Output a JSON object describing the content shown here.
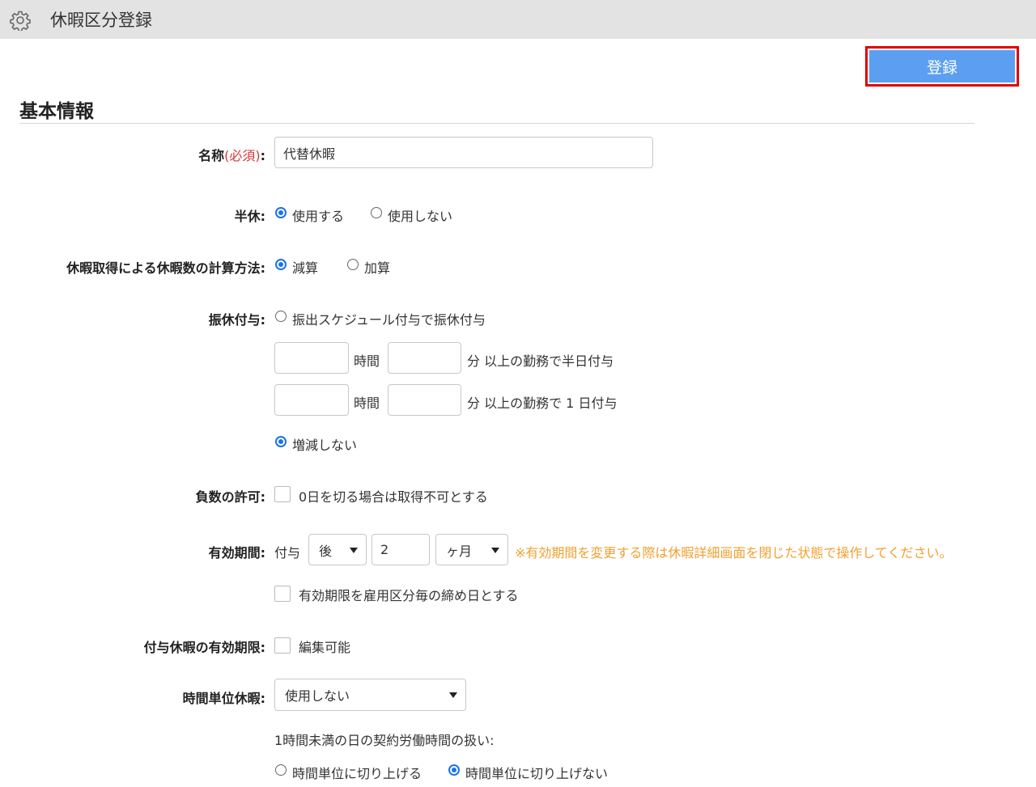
{
  "header": {
    "title": "休暇区分登録",
    "icon": "gear-icon"
  },
  "actions": {
    "submit_label": "登録"
  },
  "section": {
    "title": "基本情報"
  },
  "name_field": {
    "label": "名称",
    "required": "(必須)",
    "colon": ":",
    "value": "代替休暇"
  },
  "half_day": {
    "label": "半休:",
    "options": [
      "使用する",
      "使用しない"
    ],
    "selected": "使用する"
  },
  "calc_method": {
    "label": "休暇取得による休暇数の計算方法:",
    "options": [
      "減算",
      "加算"
    ],
    "selected": "減算"
  },
  "substitute": {
    "label": "振休付与:",
    "option_schedule": "振出スケジュール付与で振休付与",
    "row1": {
      "hours_unit": "時間",
      "minutes_suffix": "分 以上の勤務で半日付与",
      "hours": "",
      "minutes": ""
    },
    "row2": {
      "hours_unit": "時間",
      "minutes_suffix": "分 以上の勤務で 1 日付与",
      "hours": "",
      "minutes": ""
    },
    "option_none": "増減しない",
    "selected": "増減しない"
  },
  "negative": {
    "label": "負数の許可:",
    "checkbox_label": "0日を切る場合は取得不可とする",
    "checked": false
  },
  "validity": {
    "label": "有効期間:",
    "prefix": "付与",
    "direction": "後",
    "amount": "2",
    "unit": "ヶ月",
    "note": "※有効期間を変更する際は休暇詳細画面を閉じた状態で操作してください。",
    "closing_checkbox_label": "有効期限を雇用区分毎の締め日とする",
    "closing_checked": false
  },
  "granted_expiry": {
    "label": "付与休暇の有効期限:",
    "checkbox_label": "編集可能",
    "checked": false
  },
  "hourly": {
    "label": "時間単位休暇:",
    "select_value": "使用しない",
    "sub_label": "1時間未満の日の契約労働時間の扱い:",
    "options": [
      "時間単位に切り上げる",
      "時間単位に切り上げない"
    ],
    "selected": "時間単位に切り上げない"
  },
  "colors": {
    "accent": "#5c9ff0",
    "required": "#d0383a",
    "note": "#f0a030",
    "highlight_border": "#e00000"
  }
}
